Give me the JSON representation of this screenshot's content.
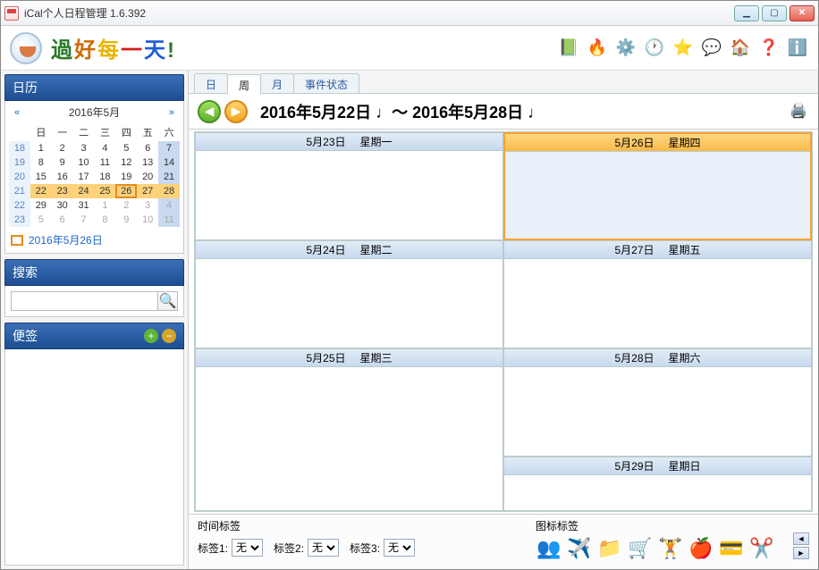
{
  "window": {
    "title": "iCal个人日程管理    1.6.392"
  },
  "slogan": [
    "過",
    "好",
    "每",
    "一",
    "天",
    "!"
  ],
  "toolbar_icons": [
    {
      "name": "book-icon",
      "glyph": "📗"
    },
    {
      "name": "fire-icon",
      "glyph": "🔥"
    },
    {
      "name": "gear-icon",
      "glyph": "⚙️"
    },
    {
      "name": "clock-icon",
      "glyph": "🕐"
    },
    {
      "name": "star-icon",
      "glyph": "⭐"
    },
    {
      "name": "chat-icon",
      "glyph": "💬"
    },
    {
      "name": "home-icon",
      "glyph": "🏠"
    },
    {
      "name": "help-icon",
      "glyph": "❓"
    },
    {
      "name": "info-icon",
      "glyph": "ℹ️"
    }
  ],
  "sidebar": {
    "calendar_hdr": "日历",
    "cal_title": "2016年5月",
    "dow": [
      "日",
      "一",
      "二",
      "三",
      "四",
      "五",
      "六"
    ],
    "weeks": [
      {
        "wk": "18",
        "days": [
          {
            "n": "1",
            "sat": false
          },
          {
            "n": "2"
          },
          {
            "n": "3"
          },
          {
            "n": "4"
          },
          {
            "n": "5"
          },
          {
            "n": "6"
          },
          {
            "n": "7",
            "sat": true
          }
        ]
      },
      {
        "wk": "19",
        "days": [
          {
            "n": "8"
          },
          {
            "n": "9"
          },
          {
            "n": "10"
          },
          {
            "n": "11"
          },
          {
            "n": "12"
          },
          {
            "n": "13"
          },
          {
            "n": "14",
            "sat": true
          }
        ]
      },
      {
        "wk": "20",
        "days": [
          {
            "n": "15"
          },
          {
            "n": "16"
          },
          {
            "n": "17"
          },
          {
            "n": "18"
          },
          {
            "n": "19"
          },
          {
            "n": "20"
          },
          {
            "n": "21",
            "sat": true
          }
        ]
      },
      {
        "wk": "21",
        "days": [
          {
            "n": "22",
            "sel": true
          },
          {
            "n": "23",
            "sel": true
          },
          {
            "n": "24",
            "sel": true
          },
          {
            "n": "25",
            "sel": true
          },
          {
            "n": "26",
            "today": true
          },
          {
            "n": "27",
            "sel": true
          },
          {
            "n": "28",
            "sel": true,
            "sat": true
          }
        ]
      },
      {
        "wk": "22",
        "days": [
          {
            "n": "29"
          },
          {
            "n": "30"
          },
          {
            "n": "31"
          },
          {
            "n": "1",
            "dim": true
          },
          {
            "n": "2",
            "dim": true
          },
          {
            "n": "3",
            "dim": true
          },
          {
            "n": "4",
            "dim": true,
            "sat": true
          }
        ]
      },
      {
        "wk": "23",
        "days": [
          {
            "n": "5",
            "dim": true
          },
          {
            "n": "6",
            "dim": true
          },
          {
            "n": "7",
            "dim": true
          },
          {
            "n": "8",
            "dim": true
          },
          {
            "n": "9",
            "dim": true
          },
          {
            "n": "10",
            "dim": true
          },
          {
            "n": "11",
            "dim": true,
            "sat": true
          }
        ]
      }
    ],
    "today_label": "2016年5月26日",
    "search_hdr": "搜索",
    "notes_hdr": "便签"
  },
  "tabs": [
    {
      "label": "日",
      "active": false
    },
    {
      "label": "周",
      "active": true
    },
    {
      "label": "月",
      "active": false
    },
    {
      "label": "事件状态",
      "active": false
    }
  ],
  "date_range": "2016年5月22日 ♩～  2016年5月28日 ♩",
  "week_days": [
    {
      "date": "5月23日",
      "dow": "星期一"
    },
    {
      "date": "5月26日",
      "dow": "星期四",
      "today": true
    },
    {
      "date": "5月24日",
      "dow": "星期二"
    },
    {
      "date": "5月27日",
      "dow": "星期五"
    },
    {
      "date": "5月25日",
      "dow": "星期三"
    },
    {
      "date": "5月28日",
      "dow": "星期六"
    },
    {
      "date": "5月29日",
      "dow": "星期日"
    }
  ],
  "bottom": {
    "time_tag_hdr": "时间标签",
    "labels": [
      {
        "lbl": "标签1:",
        "val": "无"
      },
      {
        "lbl": "标签2:",
        "val": "无"
      },
      {
        "lbl": "标签3:",
        "val": "无"
      }
    ],
    "icon_tag_hdr": "图标标签",
    "icons": [
      {
        "name": "people-icon",
        "glyph": "👥"
      },
      {
        "name": "plane-icon",
        "glyph": "✈️"
      },
      {
        "name": "folder-icon",
        "glyph": "📁"
      },
      {
        "name": "shopping-icon",
        "glyph": "🛒"
      },
      {
        "name": "fitness-icon",
        "glyph": "🏋️"
      },
      {
        "name": "food-icon",
        "glyph": "🍎"
      },
      {
        "name": "card-icon",
        "glyph": "💳"
      },
      {
        "name": "cut-icon",
        "glyph": "✂️"
      }
    ]
  }
}
